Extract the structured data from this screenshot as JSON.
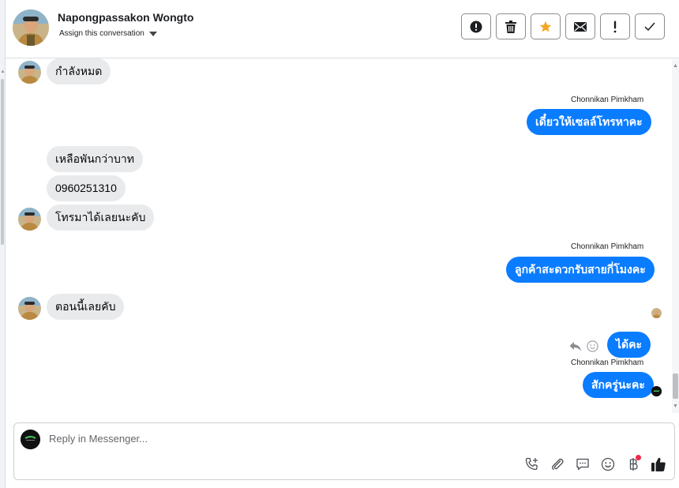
{
  "header": {
    "contact_name": "Napongpassakon Wongto",
    "assign_label": "Assign this conversation"
  },
  "actions": [
    {
      "name": "spam-button",
      "icon": "alert-circle-icon"
    },
    {
      "name": "delete-button",
      "icon": "trash-icon"
    },
    {
      "name": "star-button",
      "icon": "star-icon"
    },
    {
      "name": "mark-unread-button",
      "icon": "envelope-icon"
    },
    {
      "name": "follow-up-button",
      "icon": "exclamation-icon"
    },
    {
      "name": "done-button",
      "icon": "check-icon"
    }
  ],
  "messages": {
    "m1": {
      "text": "กำลังหมด"
    },
    "s1": {
      "sender": "Chonnikan Pimkham",
      "text": "เดี๋ยวให้เซลล์โทรหาคะ"
    },
    "m2": {
      "text": "เหลือพันกว่าบาท"
    },
    "m3": {
      "text": "0960251310"
    },
    "m4": {
      "text": "โทรมาได้เลยนะคับ"
    },
    "s2": {
      "sender": "Chonnikan Pimkham",
      "text": "ลูกค้าสะดวกรับสายกี่โมงคะ"
    },
    "m5": {
      "text": "ตอนนี้เลยคับ"
    },
    "s3": {
      "text": "ได้คะ"
    },
    "s4": {
      "sender": "Chonnikan Pimkham",
      "text": "สักครู่นะคะ"
    }
  },
  "composer": {
    "placeholder": "Reply in Messenger...",
    "tools": [
      "call-add-icon",
      "paperclip-icon",
      "saved-reply-icon",
      "emoji-icon",
      "baht-icon",
      "thumbs-up-icon"
    ]
  },
  "colors": {
    "outgoing_bubble": "#0a7cff",
    "incoming_bubble": "#e9eaec",
    "star": "#f5a623",
    "notification_dot": "#f02849"
  }
}
